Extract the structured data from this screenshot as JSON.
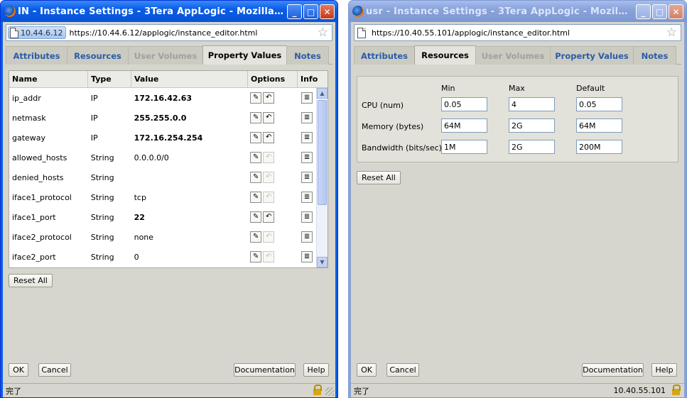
{
  "left_window": {
    "title": "IN - Instance Settings - 3Tera AppLogic - Mozilla Fire...",
    "site_badge": "10.44.6.12",
    "url": "https://10.44.6.12/applogic/instance_editor.html",
    "tabs": [
      "Attributes",
      "Resources",
      "User Volumes",
      "Property Values",
      "Notes"
    ],
    "active_tab": "Property Values",
    "table": {
      "headers": [
        "Name",
        "Type",
        "Value",
        "Options",
        "Info"
      ],
      "rows": [
        {
          "name": "ip_addr",
          "type": "IP",
          "value": "172.16.42.63"
        },
        {
          "name": "netmask",
          "type": "IP",
          "value": "255.255.0.0"
        },
        {
          "name": "gateway",
          "type": "IP",
          "value": "172.16.254.254"
        },
        {
          "name": "allowed_hosts",
          "type": "String",
          "value": "0.0.0.0/0"
        },
        {
          "name": "denied_hosts",
          "type": "String",
          "value": ""
        },
        {
          "name": "iface1_protocol",
          "type": "String",
          "value": "tcp"
        },
        {
          "name": "iface1_port",
          "type": "String",
          "value": "22"
        },
        {
          "name": "iface2_protocol",
          "type": "String",
          "value": "none"
        },
        {
          "name": "iface2_port",
          "type": "String",
          "value": "0"
        }
      ]
    },
    "reset_all": "Reset All",
    "ok": "OK",
    "cancel": "Cancel",
    "documentation": "Documentation",
    "help": "Help",
    "status": "完了"
  },
  "right_window": {
    "title": "usr - Instance Settings - 3Tera AppLogic - Mozilla Fir...",
    "url": "https://10.40.55.101/applogic/instance_editor.html",
    "tabs": [
      "Attributes",
      "Resources",
      "User Volumes",
      "Property Values",
      "Notes"
    ],
    "active_tab": "Resources",
    "resources": {
      "columns": [
        "Min",
        "Max",
        "Default"
      ],
      "rows": [
        {
          "label": "CPU (num)",
          "min": "0.05",
          "max": "4",
          "default": "0.05"
        },
        {
          "label": "Memory (bytes)",
          "min": "64M",
          "max": "2G",
          "default": "64M"
        },
        {
          "label": "Bandwidth (bits/sec)",
          "min": "1M",
          "max": "2G",
          "default": "200M"
        }
      ]
    },
    "reset_all": "Reset All",
    "ok": "OK",
    "cancel": "Cancel",
    "documentation": "Documentation",
    "help": "Help",
    "status": "完了",
    "status_host": "10.40.55.101"
  }
}
